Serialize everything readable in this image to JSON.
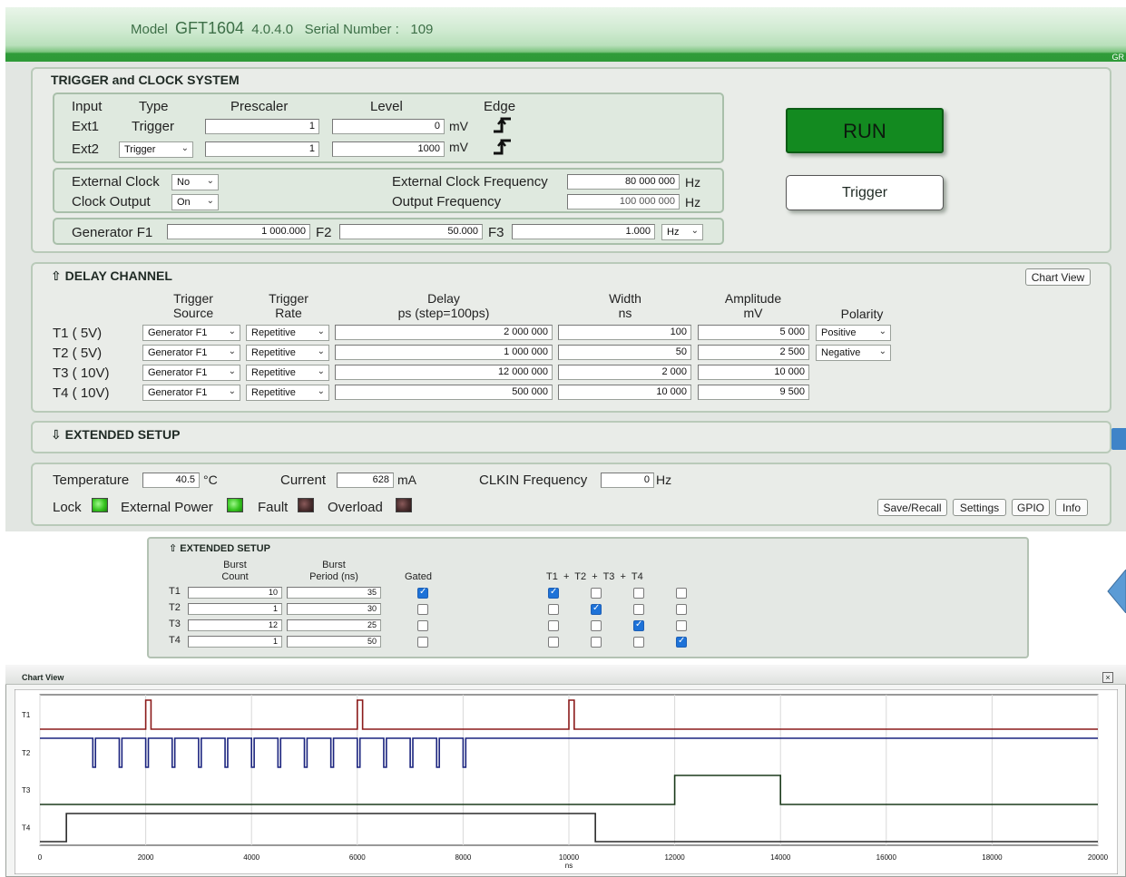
{
  "header": {
    "model_label": "Model",
    "model": "GFT1604",
    "version": "4.0.4.0",
    "serial_label": "Serial Number :",
    "serial": "109",
    "corner_text": "GR"
  },
  "trigger_clock": {
    "title": "TRIGGER and CLOCK SYSTEM",
    "col_input": "Input",
    "col_type": "Type",
    "col_prescaler": "Prescaler",
    "col_level": "Level",
    "col_edge": "Edge",
    "ext1": {
      "name": "Ext1",
      "type": "Trigger",
      "prescaler": "1",
      "level": "0",
      "unit": "mV"
    },
    "ext2": {
      "name": "Ext2",
      "type": "Trigger",
      "prescaler": "1",
      "level": "1000",
      "unit": "mV"
    },
    "external_clock_label": "External Clock",
    "external_clock_value": "No",
    "clock_output_label": "Clock Output",
    "clock_output_value": "On",
    "ext_clock_freq_label": "External Clock Frequency",
    "ext_clock_freq_value": "80 000 000",
    "output_freq_label": "Output Frequency",
    "output_freq_value": "100 000 000",
    "hz": "Hz",
    "generator_label": "Generator F1",
    "f1_value": "1 000.000",
    "f2_label": "F2",
    "f2_value": "50.000",
    "f3_label": "F3",
    "f3_value": "1.000",
    "freq_unit": "Hz",
    "run_label": "RUN",
    "trigger_label": "Trigger"
  },
  "delay_channel": {
    "title": "DELAY CHANNEL",
    "chart_view_label": "Chart View",
    "headers": {
      "trigger_source_1": "Trigger",
      "trigger_source_2": "Source",
      "trigger_rate_1": "Trigger",
      "trigger_rate_2": "Rate",
      "delay_1": "Delay",
      "delay_2": "ps (step=100ps)",
      "width_1": "Width",
      "width_2": "ns",
      "amplitude_1": "Amplitude",
      "amplitude_2": "mV",
      "polarity": "Polarity"
    },
    "rows": [
      {
        "name": "T1 ( 5V)",
        "source": "Generator F1",
        "rate": "Repetitive",
        "delay": "2 000 000",
        "width": "100",
        "amplitude": "5 000",
        "polarity": "Positive"
      },
      {
        "name": "T2 ( 5V)",
        "source": "Generator F1",
        "rate": "Repetitive",
        "delay": "1 000 000",
        "width": "50",
        "amplitude": "2 500",
        "polarity": "Negative"
      },
      {
        "name": "T3 ( 10V)",
        "source": "Generator F1",
        "rate": "Repetitive",
        "delay": "12 000 000",
        "width": "2 000",
        "amplitude": "10 000",
        "polarity": ""
      },
      {
        "name": "T4 ( 10V)",
        "source": "Generator F1",
        "rate": "Repetitive",
        "delay": "500 000",
        "width": "10 000",
        "amplitude": "9 500",
        "polarity": ""
      }
    ]
  },
  "extended_setup_collapsed": {
    "title": "EXTENDED SETUP"
  },
  "status": {
    "temperature_label": "Temperature",
    "temperature_value": "40.5",
    "temperature_unit": "°C",
    "current_label": "Current",
    "current_value": "628",
    "current_unit": "mA",
    "clkin_label": "CLKIN Frequency",
    "clkin_value": "0",
    "clkin_unit": "Hz",
    "lock_label": "Lock",
    "ext_power_label": "External Power",
    "fault_label": "Fault",
    "overload_label": "Overload",
    "save_recall": "Save/Recall",
    "settings": "Settings",
    "gpio": "GPIO",
    "info": "Info"
  },
  "extended_setup": {
    "title": "EXTENDED SETUP",
    "burst_count_1": "Burst",
    "burst_count_2": "Count",
    "burst_period_1": "Burst",
    "burst_period_2": "Period (ns)",
    "gated": "Gated",
    "sum_header": "T1  +  T2  +  T3  +  T4",
    "rows": [
      {
        "name": "T1",
        "count": "10",
        "period": "35",
        "gated": true,
        "t1": true,
        "t2": false,
        "t3": false,
        "t4": false
      },
      {
        "name": "T2",
        "count": "1",
        "period": "30",
        "gated": false,
        "t1": false,
        "t2": true,
        "t3": false,
        "t4": false
      },
      {
        "name": "T3",
        "count": "12",
        "period": "25",
        "gated": false,
        "t1": false,
        "t2": false,
        "t3": true,
        "t4": false
      },
      {
        "name": "T4",
        "count": "1",
        "period": "50",
        "gated": false,
        "t1": false,
        "t2": false,
        "t3": false,
        "t4": true
      }
    ]
  },
  "chart_view": {
    "title": "Chart View",
    "close": "×"
  },
  "chart_data": {
    "type": "line",
    "xlabel": "ns",
    "xlim": [
      0,
      20000
    ],
    "xticks": [
      "0",
      "2000",
      "4000",
      "6000",
      "8000",
      "10000",
      "12000",
      "14000",
      "16000",
      "18000",
      "20000"
    ],
    "grid": true,
    "series": [
      {
        "name": "T1",
        "color": "#8b1a1a",
        "polarity": "positive",
        "pulses": [
          [
            2000,
            2100
          ],
          [
            6000,
            6100
          ],
          [
            10000,
            10100
          ]
        ]
      },
      {
        "name": "T2",
        "color": "#1a237e",
        "polarity": "negative",
        "pulses": [
          [
            1000,
            1050
          ],
          [
            1500,
            1550
          ],
          [
            2000,
            2050
          ],
          [
            2500,
            2550
          ],
          [
            3000,
            3050
          ],
          [
            3500,
            3550
          ],
          [
            4000,
            4050
          ],
          [
            4500,
            4550
          ],
          [
            5000,
            5050
          ],
          [
            5500,
            5550
          ],
          [
            6000,
            6050
          ],
          [
            6500,
            6550
          ],
          [
            7000,
            7050
          ],
          [
            7500,
            7550
          ],
          [
            8000,
            8050
          ]
        ]
      },
      {
        "name": "T3",
        "color": "#1b3a1b",
        "polarity": "positive",
        "pulses": [
          [
            12000,
            14000
          ]
        ]
      },
      {
        "name": "T4",
        "color": "#2a2a2a",
        "polarity": "positive",
        "pulses": [
          [
            500,
            10500
          ]
        ]
      }
    ]
  },
  "colors": {
    "header_green": "#2e9a38",
    "run_green": "#138a20",
    "panel_bg": "#e9ece8",
    "checkbox_blue": "#1d72d8"
  }
}
